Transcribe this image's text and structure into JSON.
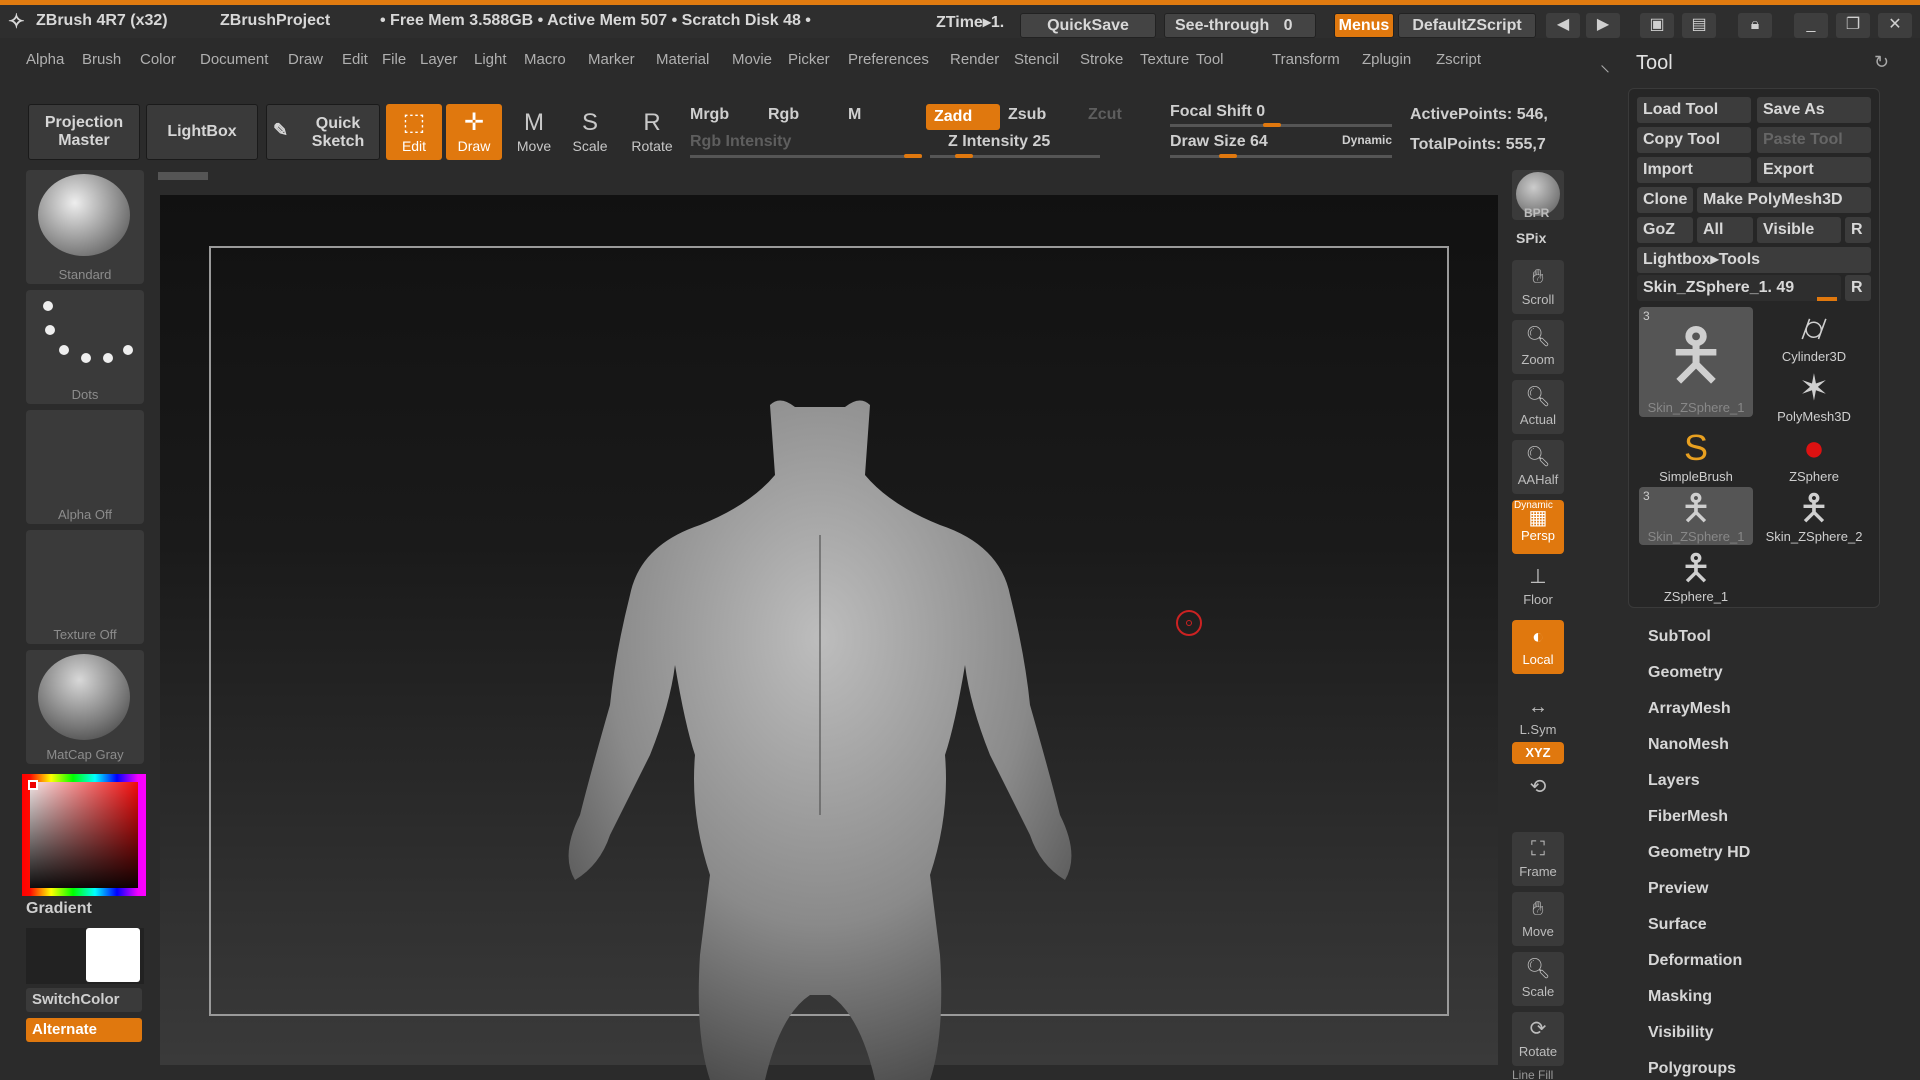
{
  "titlebar": {
    "app": "ZBrush 4R7 (x32)",
    "project": "ZBrushProject",
    "stats": "• Free Mem 3.588GB • Active Mem 507 • Scratch Disk 48 •",
    "ztime": "ZTime▸1.",
    "quicksave": "QuickSave",
    "seethrough": "See-through",
    "seethrough_value": "0",
    "menus": "Menus",
    "script": "DefaultZScript"
  },
  "menu": [
    "Alpha",
    "Brush",
    "Color",
    "Document",
    "Draw",
    "Edit",
    "File",
    "Layer",
    "Light",
    "Macro",
    "Marker",
    "Material",
    "Movie",
    "Picker",
    "Preferences",
    "Render",
    "Stencil",
    "Stroke",
    "Texture",
    "Tool",
    "Transform",
    "Zplugin",
    "Zscript"
  ],
  "toolbar": {
    "projection_master": "Projection Master",
    "lightbox": "LightBox",
    "quick_sketch": "Quick Sketch",
    "edit": "Edit",
    "draw": "Draw",
    "move": "Move",
    "scale": "Scale",
    "rotate": "Rotate",
    "mrgb": "Mrgb",
    "rgb": "Rgb",
    "m": "M",
    "rgb_intensity": "Rgb Intensity",
    "zadd": "Zadd",
    "zsub": "Zsub",
    "zcut": "Zcut",
    "z_intensity": "Z Intensity 25",
    "focal_shift": "Focal Shift 0",
    "draw_size": "Draw Size 64",
    "dynamic": "Dynamic",
    "active_points": "ActivePoints: 546,",
    "total_points": "TotalPoints: 555,7"
  },
  "slider_levels": {
    "rgb_intensity": 1.0,
    "z_intensity": 0.25,
    "focal_shift": 0.5,
    "draw_size": 0.3
  },
  "left_shelf": {
    "brush": "Standard",
    "stroke": "Dots",
    "alpha": "Alpha Off",
    "texture": "Texture Off",
    "material": "MatCap Gray",
    "gradient": "Gradient",
    "switch_color": "SwitchColor",
    "alternate": "Alternate"
  },
  "right_shelf": {
    "bpr": "BPR",
    "spix": "SPix",
    "scroll": "Scroll",
    "zoom": "Zoom",
    "actual": "Actual",
    "aahalf": "AAHalf",
    "dynamic": "Dynamic",
    "persp": "Persp",
    "floor": "Floor",
    "local": "Local",
    "lsym": "L.Sym",
    "xyz": "XYZ",
    "frame": "Frame",
    "move": "Move",
    "scale": "Scale",
    "rotate": "Rotate",
    "line_fill": "Line Fill"
  },
  "tool_panel": {
    "title": "Tool",
    "load_tool": "Load Tool",
    "save_as": "Save As",
    "copy_tool": "Copy Tool",
    "paste_tool": "Paste Tool",
    "import": "Import",
    "export": "Export",
    "clone": "Clone",
    "make_polymesh": "Make PolyMesh3D",
    "goz": "GoZ",
    "all": "All",
    "visible": "Visible",
    "r": "R",
    "lightbox_tools": "Lightbox▸Tools",
    "current_tool": "Skin_ZSphere_1. 49",
    "thumbs": [
      {
        "label": "Skin_ZSphere_1",
        "count": "3",
        "icon": "figure-icon"
      },
      {
        "label": "Cylinder3D",
        "count": "",
        "icon": "cylinder-icon"
      },
      {
        "label": "PolyMesh3D",
        "count": "",
        "icon": "star-icon"
      },
      {
        "label": "SimpleBrush",
        "count": "",
        "icon": "s-brush-icon"
      },
      {
        "label": "ZSphere",
        "count": "",
        "icon": "sphere-icon"
      },
      {
        "label": "Skin_ZSphere_1",
        "count": "3",
        "icon": "figure-icon"
      },
      {
        "label": "Skin_ZSphere_2",
        "count": "",
        "icon": "figure-icon"
      },
      {
        "label": "ZSphere_1",
        "count": "",
        "icon": "figure-icon"
      }
    ]
  },
  "sections": [
    "SubTool",
    "Geometry",
    "ArrayMesh",
    "NanoMesh",
    "Layers",
    "FiberMesh",
    "Geometry HD",
    "Preview",
    "Surface",
    "Deformation",
    "Masking",
    "Visibility",
    "Polygroups"
  ],
  "colors": {
    "accent": "#e0780e",
    "background": "#2b2b2b"
  }
}
